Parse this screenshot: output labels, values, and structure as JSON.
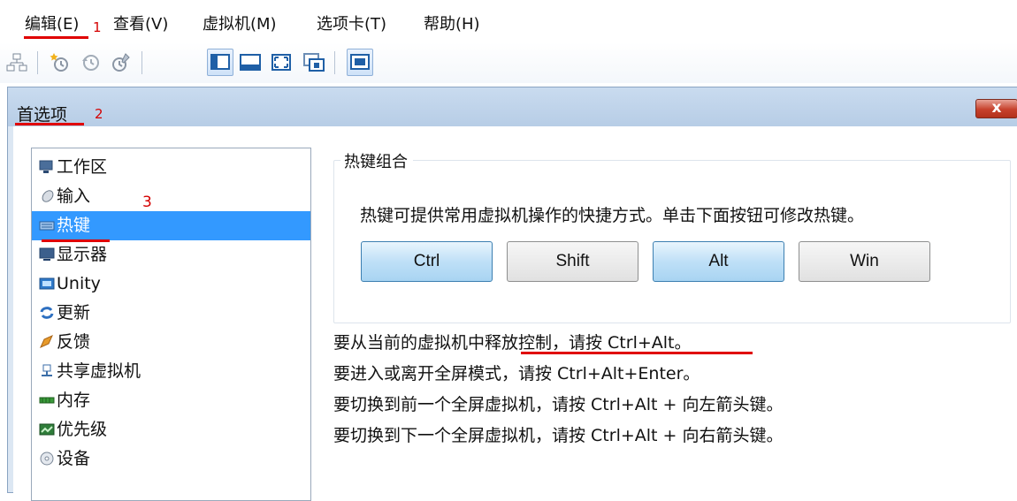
{
  "menu": {
    "items": [
      {
        "label": "编辑(E)"
      },
      {
        "label": "查看(V)"
      },
      {
        "label": "虚拟机(M)"
      },
      {
        "label": "选项卡(T)"
      },
      {
        "label": "帮助(H)"
      }
    ]
  },
  "annotations": {
    "a1": "1",
    "a2": "2",
    "a3": "3"
  },
  "toolbar": {
    "icons": [
      "network-icon",
      "snapshot-icon",
      "revert-snapshot-icon",
      "manage-snapshots-icon",
      "console-view-icon",
      "fullscreen-icon",
      "fit-window-icon",
      "unity-icon",
      "thumbnail-view-icon"
    ]
  },
  "dialog": {
    "title": "首选项",
    "close_label": "x"
  },
  "sidebar": {
    "items": [
      {
        "label": "工作区",
        "icon": "workspace-icon"
      },
      {
        "label": "输入",
        "icon": "mouse-icon"
      },
      {
        "label": "热键",
        "icon": "keyboard-icon",
        "selected": true
      },
      {
        "label": "显示器",
        "icon": "monitor-icon"
      },
      {
        "label": "Unity",
        "icon": "unity-icon"
      },
      {
        "label": "更新",
        "icon": "update-icon"
      },
      {
        "label": "反馈",
        "icon": "feedback-icon"
      },
      {
        "label": "共享虚拟机",
        "icon": "shared-vm-icon"
      },
      {
        "label": "内存",
        "icon": "memory-icon"
      },
      {
        "label": "优先级",
        "icon": "priority-icon"
      },
      {
        "label": "设备",
        "icon": "device-icon"
      }
    ]
  },
  "hotkeys": {
    "group_title": "热键组合",
    "description": "热键可提供常用虚拟机操作的快捷方式。单击下面按钮可修改热键。",
    "buttons": [
      {
        "label": "Ctrl",
        "pressed": true
      },
      {
        "label": "Shift",
        "pressed": false
      },
      {
        "label": "Alt",
        "pressed": true
      },
      {
        "label": "Win",
        "pressed": false
      }
    ]
  },
  "info": {
    "line1": "要从当前的虚拟机中释放控制，请按 Ctrl+Alt。",
    "line2": "要进入或离开全屏模式，请按 Ctrl+Alt+Enter。",
    "line3": "要切换到前一个全屏虚拟机，请按 Ctrl+Alt + 向左箭头键。",
    "line4": "要切换到下一个全屏虚拟机，请按 Ctrl+Alt + 向右箭头键。"
  },
  "colors": {
    "selection": "#3399ff",
    "annotation_red": "#e00000",
    "close_button": "#c6412c"
  }
}
